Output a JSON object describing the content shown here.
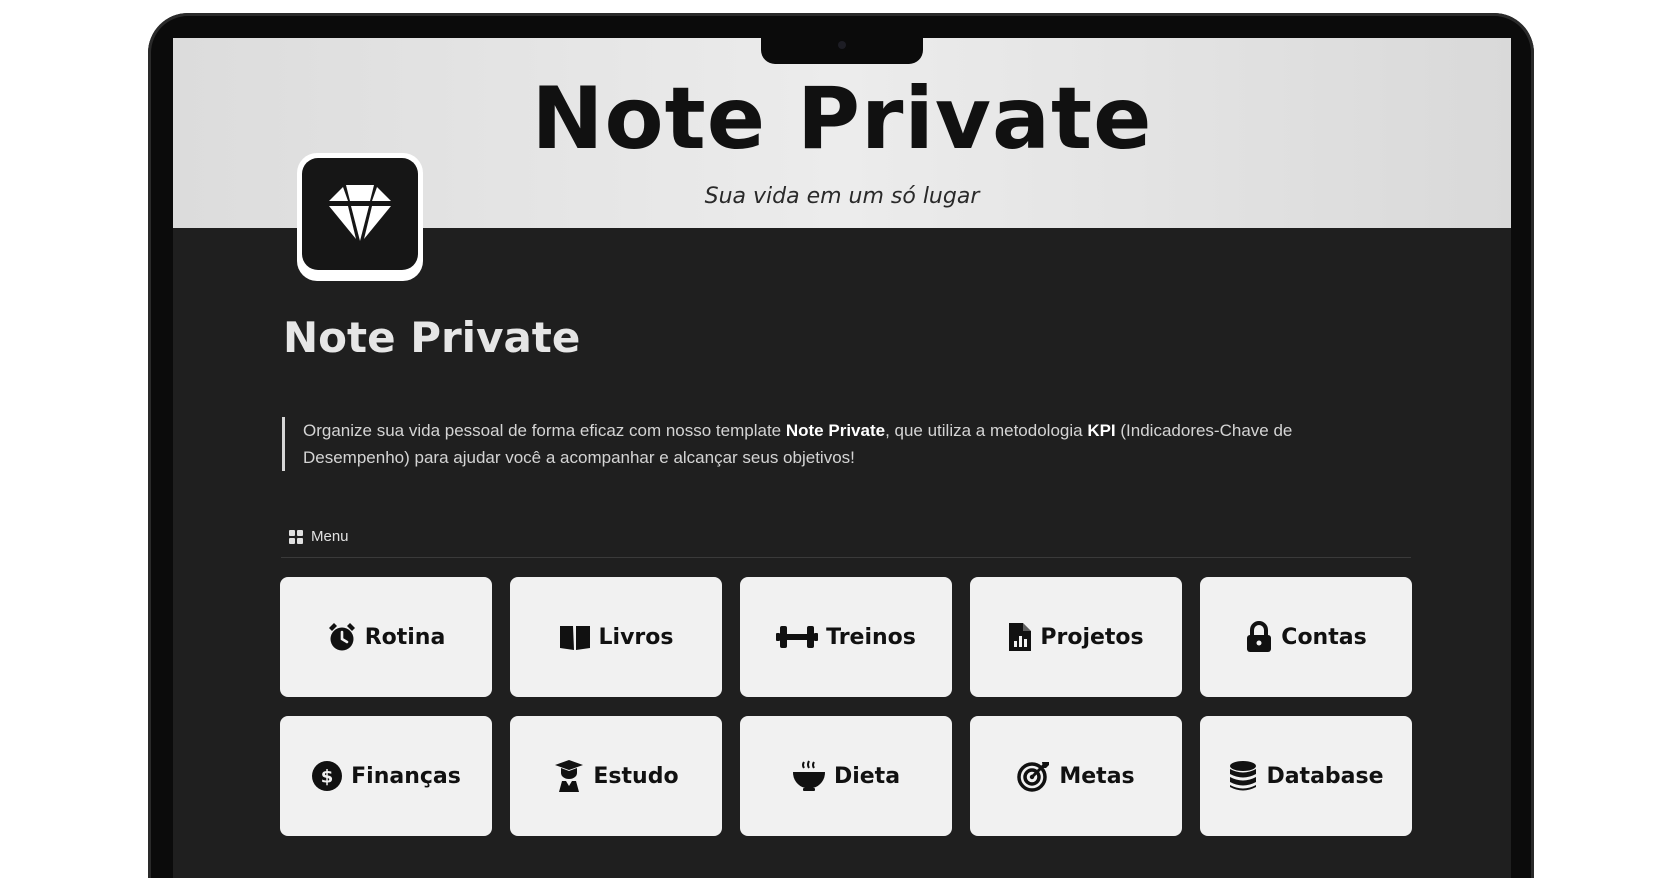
{
  "cover": {
    "title": "Note Private",
    "subtitle": "Sua vida em um só lugar"
  },
  "page": {
    "icon": "diamond-icon",
    "title": "Note Private"
  },
  "description": {
    "part1": "Organize sua vida pessoal de forma eficaz com nosso template ",
    "bold1": "Note Private",
    "part2": ", que utiliza a metodologia ",
    "bold2": "KPI",
    "part3": " (Indicadores-Chave de Desempenho) para ajudar você a acompanhar e alcançar seus objetivos!"
  },
  "menu": {
    "icon": "grid-icon",
    "label": "Menu",
    "items": [
      {
        "label": "Rotina",
        "icon": "alarm-clock-icon"
      },
      {
        "label": "Livros",
        "icon": "book-icon"
      },
      {
        "label": "Treinos",
        "icon": "dumbbell-icon"
      },
      {
        "label": "Projetos",
        "icon": "chart-file-icon"
      },
      {
        "label": "Contas",
        "icon": "lock-icon"
      },
      {
        "label": "Finanças",
        "icon": "dollar-coin-icon"
      },
      {
        "label": "Estudo",
        "icon": "graduate-icon"
      },
      {
        "label": "Dieta",
        "icon": "bowl-icon"
      },
      {
        "label": "Metas",
        "icon": "target-icon"
      },
      {
        "label": "Database",
        "icon": "database-icon"
      }
    ]
  }
}
